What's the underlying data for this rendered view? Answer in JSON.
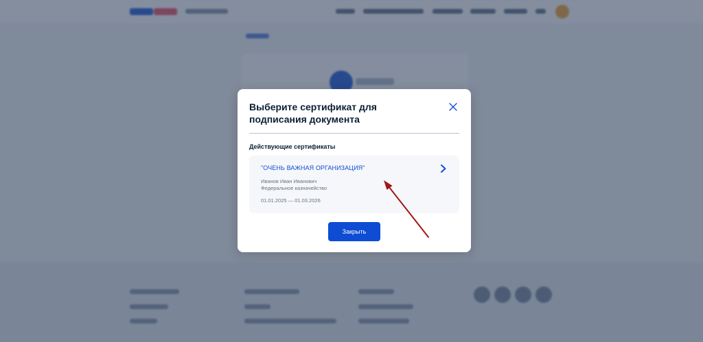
{
  "modal": {
    "title": "Выберите сертификат для подписания документа",
    "section_label": "Действующие сертификаты",
    "close_icon": "close-icon",
    "certificate": {
      "organization": "\"ОЧЕНЬ ВАЖНАЯ ОРГАНИЗАЦИЯ\"",
      "holder": "Иванов Иван Иванович",
      "issuer": "Федеральное казначейство",
      "validity": "01.01.2025 — 01.03.2026",
      "chevron_icon": "chevron-right-icon"
    },
    "close_button_label": "Закрыть"
  },
  "colors": {
    "accent": "#0d4cd3",
    "title_text": "#0b1f33",
    "secondary_text": "#66727f",
    "card_background": "#f5f7fa",
    "overlay": "#384862",
    "annotation_arrow": "#a31515"
  }
}
